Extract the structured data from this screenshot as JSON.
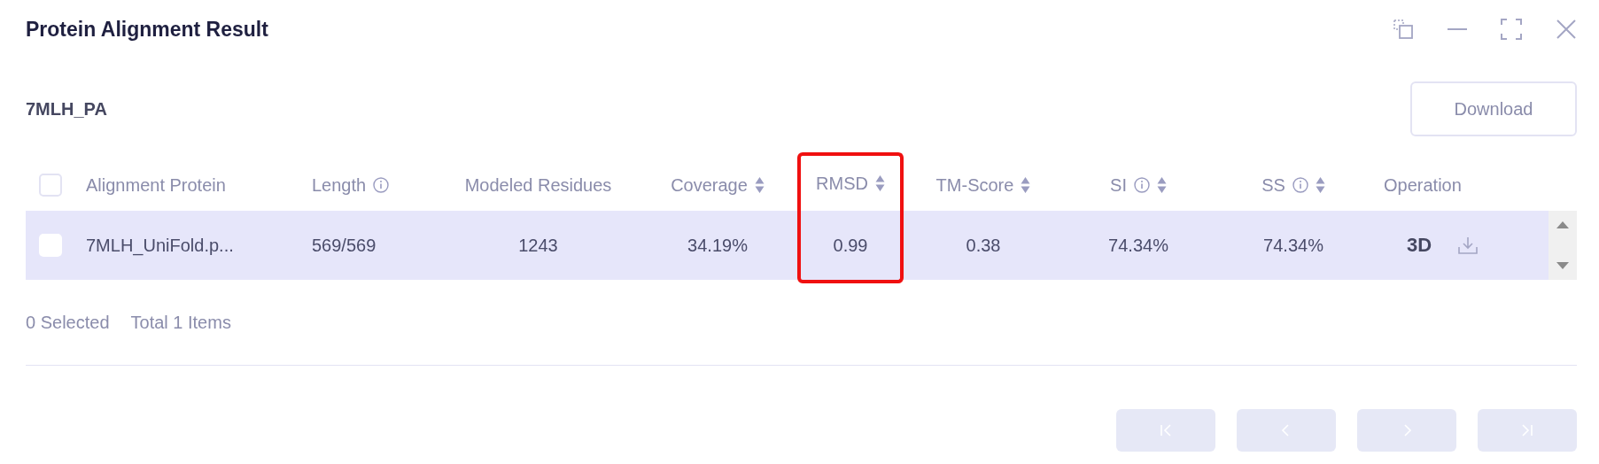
{
  "window": {
    "title": "Protein Alignment Result"
  },
  "dataset": {
    "name": "7MLH_PA"
  },
  "download_button": {
    "label": "Download"
  },
  "table": {
    "select_all": {
      "checked": false
    },
    "columns": [
      {
        "label": "Alignment Protein",
        "info": false,
        "sortable": false,
        "highlighted": false
      },
      {
        "label": "Length",
        "info": true,
        "sortable": false,
        "highlighted": false
      },
      {
        "label": "Modeled Residues",
        "info": false,
        "sortable": false,
        "highlighted": false
      },
      {
        "label": "Coverage",
        "info": false,
        "sortable": true,
        "highlighted": false
      },
      {
        "label": "RMSD",
        "info": false,
        "sortable": true,
        "highlighted": true
      },
      {
        "label": "TM-Score",
        "info": false,
        "sortable": true,
        "highlighted": false
      },
      {
        "label": "SI",
        "info": true,
        "sortable": true,
        "highlighted": false
      },
      {
        "label": "SS",
        "info": true,
        "sortable": true,
        "highlighted": false
      },
      {
        "label": "Operation",
        "info": false,
        "sortable": false,
        "highlighted": false
      }
    ],
    "rows": [
      {
        "selected": false,
        "cells": [
          "7MLH_UniFold.p...",
          "569/569",
          "1243",
          "34.19%",
          "0.99",
          "0.38",
          "74.34%",
          "74.34%"
        ],
        "view_3d": "3D"
      }
    ]
  },
  "footer": {
    "selected": "0 Selected",
    "total": "Total 1 Items"
  },
  "pagination": [
    {
      "kind": "first",
      "disabled": true
    },
    {
      "kind": "prev",
      "disabled": true
    },
    {
      "kind": "next",
      "disabled": true
    },
    {
      "kind": "last",
      "disabled": true
    }
  ]
}
